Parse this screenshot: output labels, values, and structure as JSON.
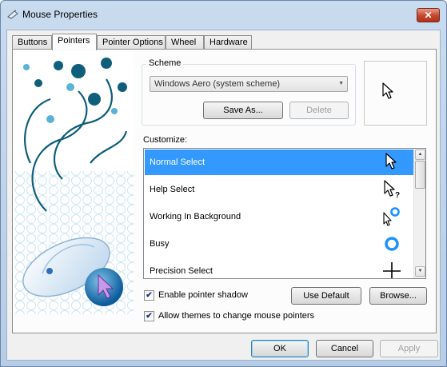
{
  "window": {
    "title": "Mouse Properties",
    "close_glyph": "✕"
  },
  "tabs": [
    "Buttons",
    "Pointers",
    "Pointer Options",
    "Wheel",
    "Hardware"
  ],
  "active_tab": "Pointers",
  "scheme": {
    "group_label": "Scheme",
    "selected": "Windows Aero (system scheme)",
    "save_as_label": "Save As...",
    "delete_label": "Delete"
  },
  "customize": {
    "label": "Customize:",
    "items": [
      {
        "label": "Normal Select",
        "icon": "arrow-cursor-icon",
        "selected": true
      },
      {
        "label": "Help Select",
        "icon": "help-cursor-icon",
        "selected": false
      },
      {
        "label": "Working In Background",
        "icon": "working-cursor-icon",
        "selected": false
      },
      {
        "label": "Busy",
        "icon": "busy-cursor-icon",
        "selected": false
      },
      {
        "label": "Precision Select",
        "icon": "crosshair-cursor-icon",
        "selected": false
      }
    ]
  },
  "options": {
    "enable_shadow_label": "Enable pointer shadow",
    "enable_shadow_checked": true,
    "allow_themes_label": "Allow themes to change mouse pointers",
    "allow_themes_checked": true,
    "checkmark": "✔"
  },
  "buttons": {
    "use_default": "Use Default",
    "browse": "Browse...",
    "ok": "OK",
    "cancel": "Cancel",
    "apply": "Apply"
  },
  "colors": {
    "selection": "#3399ff",
    "busy_ring": "#1e90ff",
    "art_teal": "#0f5f7a"
  }
}
